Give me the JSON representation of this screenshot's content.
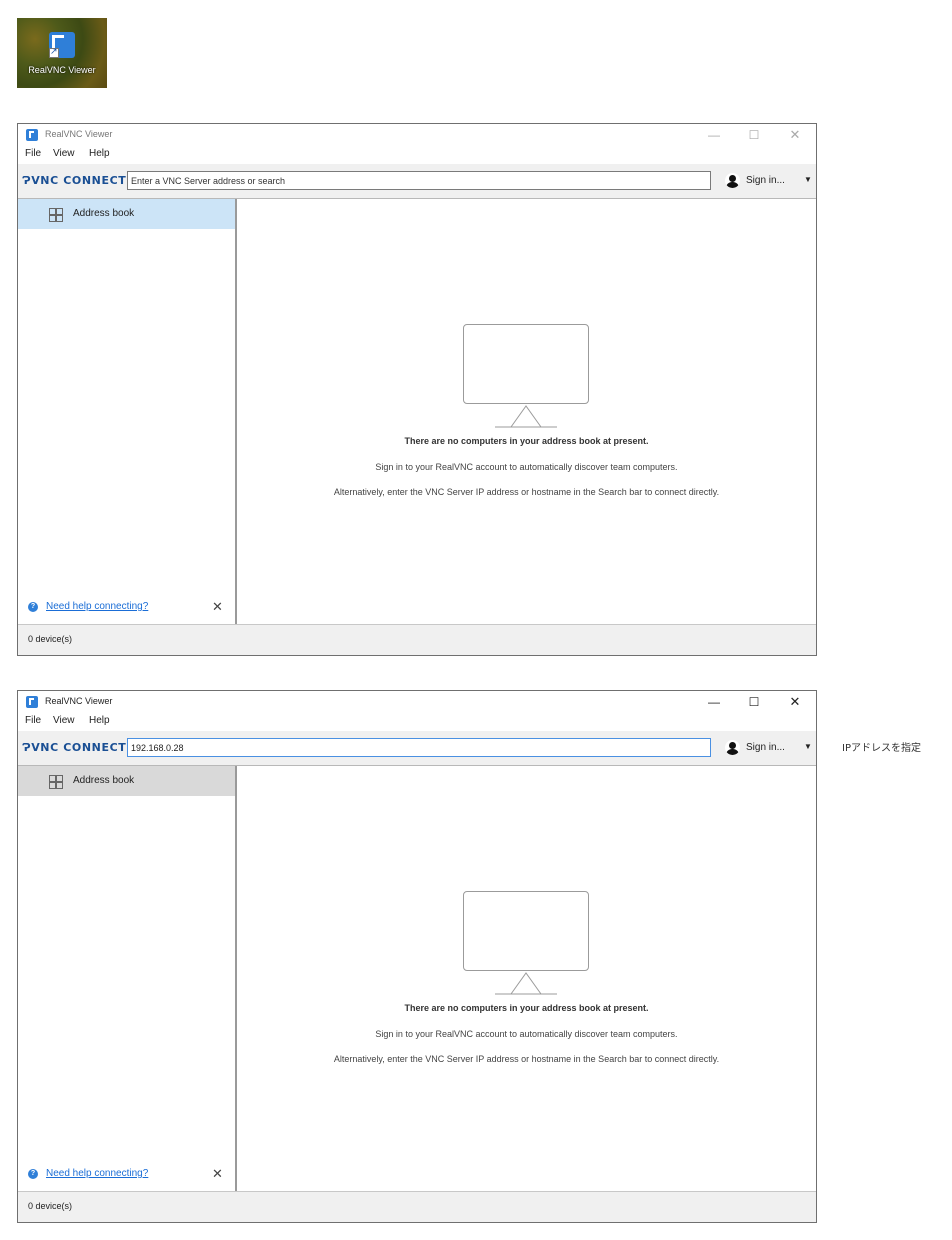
{
  "desktop": {
    "icon_label": "RealVNC Viewer",
    "icon_name": "realvnc-viewer-shortcut-icon"
  },
  "windows": [
    {
      "title": "RealVNC Viewer",
      "state": "inactive",
      "controls": {
        "minimize": "—",
        "maximize": "☐",
        "close": "✕"
      },
      "menu": [
        "File",
        "View",
        "Help"
      ],
      "toolbar": {
        "brand": "ɁVNC CONNECT",
        "search_placeholder": "Enter a VNC Server address or search",
        "search_value": "",
        "signin": "Sign in...",
        "caret": "▼"
      },
      "sidebar": {
        "address_book": "Address book",
        "help_link": "Need help connecting?",
        "help_close": "✕"
      },
      "main": {
        "empty_title": "There are no computers in your address book at present.",
        "line1": "Sign in to your RealVNC account to automatically discover team computers.",
        "line2": "Alternatively, enter the VNC Server IP address or hostname in the Search bar to connect directly."
      },
      "status": "0 device(s)"
    },
    {
      "title": "RealVNC Viewer",
      "state": "active",
      "controls": {
        "minimize": "—",
        "maximize": "☐",
        "close": "✕"
      },
      "menu": [
        "File",
        "View",
        "Help"
      ],
      "toolbar": {
        "brand": "ɁVNC CONNECT",
        "search_placeholder": "Enter a VNC Server address or search",
        "search_value": "192.168.0.28",
        "signin": "Sign in...",
        "caret": "▼"
      },
      "sidebar": {
        "address_book": "Address book",
        "help_link": "Need help connecting?",
        "help_close": "✕"
      },
      "main": {
        "empty_title": "There are no computers in your address book at present.",
        "line1": "Sign in to your RealVNC account to automatically discover team computers.",
        "line2": "Alternatively, enter the VNC Server IP address or hostname in the Search bar to connect directly."
      },
      "status": "0 device(s)"
    }
  ],
  "annotation": "IPアドレスを指定",
  "colors": {
    "accent": "#2f7fd8",
    "brand": "#1a4f94",
    "selected": "#cce4f7",
    "link": "#1a6dd6"
  }
}
